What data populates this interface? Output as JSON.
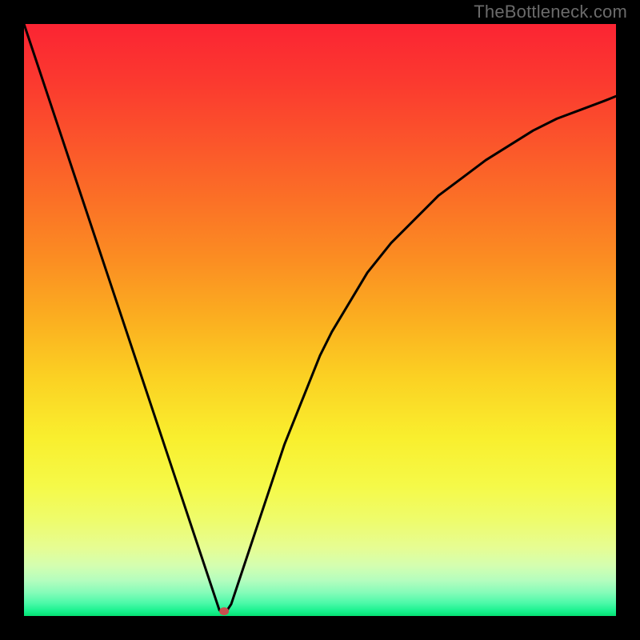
{
  "watermark": "TheBottleneck.com",
  "chart_data": {
    "type": "line",
    "title": "",
    "xlabel": "",
    "ylabel": "",
    "xlim": [
      0,
      100
    ],
    "ylim": [
      0,
      100
    ],
    "series": [
      {
        "name": "bottleneck-curve",
        "x": [
          0,
          2,
          4,
          6,
          8,
          10,
          12,
          14,
          16,
          18,
          20,
          22,
          24,
          26,
          28,
          30,
          32,
          33,
          33.5,
          34,
          35,
          36,
          38,
          40,
          42,
          44,
          46,
          48,
          50,
          52,
          55,
          58,
          62,
          66,
          70,
          74,
          78,
          82,
          86,
          90,
          94,
          98,
          100
        ],
        "y": [
          100,
          94,
          88,
          82,
          76,
          70,
          64,
          58,
          52,
          46,
          40,
          34,
          28,
          22,
          16,
          10,
          4,
          1,
          0.5,
          0.5,
          2,
          5,
          11,
          17,
          23,
          29,
          34,
          39,
          44,
          48,
          53,
          58,
          63,
          67,
          71,
          74,
          77,
          79.5,
          82,
          84,
          85.5,
          87,
          87.8
        ]
      }
    ],
    "marker": {
      "name": "bottleneck-point",
      "x": 33.8,
      "y": 0.8,
      "color": "#c94f4f",
      "rx": 6,
      "ry": 5
    },
    "background_gradient": {
      "stops": [
        {
          "offset": 0.0,
          "color": "#fb2433"
        },
        {
          "offset": 0.1,
          "color": "#fb3a2f"
        },
        {
          "offset": 0.2,
          "color": "#fb552b"
        },
        {
          "offset": 0.3,
          "color": "#fb7126"
        },
        {
          "offset": 0.4,
          "color": "#fb8e22"
        },
        {
          "offset": 0.5,
          "color": "#fbaf20"
        },
        {
          "offset": 0.6,
          "color": "#fbd223"
        },
        {
          "offset": 0.7,
          "color": "#f9ef2e"
        },
        {
          "offset": 0.78,
          "color": "#f5f948"
        },
        {
          "offset": 0.84,
          "color": "#eefc6d"
        },
        {
          "offset": 0.885,
          "color": "#e6fd93"
        },
        {
          "offset": 0.915,
          "color": "#d4feb0"
        },
        {
          "offset": 0.94,
          "color": "#b4fdbe"
        },
        {
          "offset": 0.96,
          "color": "#86fcb9"
        },
        {
          "offset": 0.978,
          "color": "#4df9a9"
        },
        {
          "offset": 0.992,
          "color": "#17f18d"
        },
        {
          "offset": 1.0,
          "color": "#05e073"
        }
      ]
    }
  }
}
